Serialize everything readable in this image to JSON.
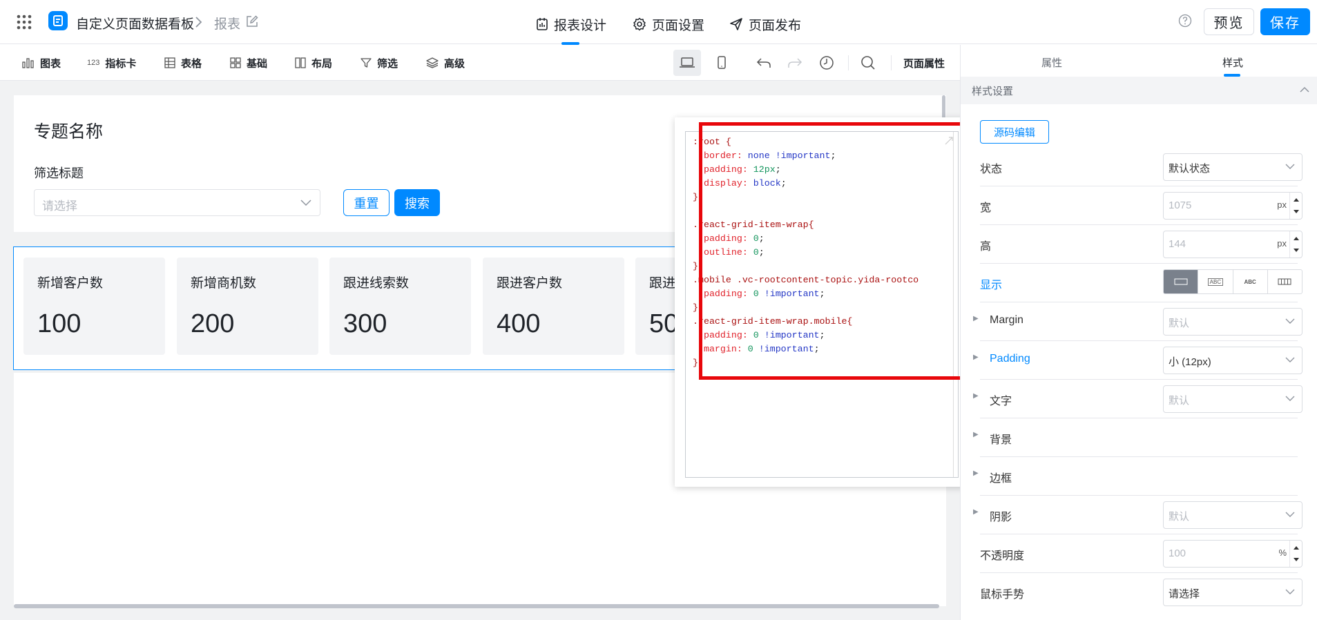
{
  "header": {
    "app_title": "自定义页面数据看板",
    "breadcrumb_page": "报表",
    "tabs": [
      {
        "label": "报表设计",
        "icon": "report-design-icon",
        "active": true
      },
      {
        "label": "页面设置",
        "icon": "gear-icon",
        "active": false
      },
      {
        "label": "页面发布",
        "icon": "send-icon",
        "active": false
      }
    ],
    "preview_label": "预览",
    "save_label": "保存",
    "accent_color": "#0089ff"
  },
  "toolbar": {
    "items": [
      {
        "label": "图表",
        "icon": "bar-chart-icon"
      },
      {
        "label": "指标卡",
        "icon": "metric-card-icon",
        "icon_text": "123"
      },
      {
        "label": "表格",
        "icon": "table-icon"
      },
      {
        "label": "基础",
        "icon": "grid-icon"
      },
      {
        "label": "布局",
        "icon": "layout-icon"
      },
      {
        "label": "筛选",
        "icon": "filter-icon"
      },
      {
        "label": "高级",
        "icon": "layers-icon"
      }
    ],
    "page_props_label": "页面属性"
  },
  "canvas": {
    "topic_title": "专题名称",
    "filter_title": "筛选标题",
    "filter_placeholder": "请选择",
    "reset_label": "重置",
    "search_label": "搜索",
    "metrics": [
      {
        "label": "新增客户数",
        "value": "100"
      },
      {
        "label": "新增商机数",
        "value": "200"
      },
      {
        "label": "跟进线索数",
        "value": "300"
      },
      {
        "label": "跟进客户数",
        "value": "400"
      },
      {
        "label": "跟进",
        "value": "50"
      }
    ]
  },
  "code_editor": {
    "lines": [
      [
        {
          "t": ":root {",
          "c": "sel"
        }
      ],
      [
        {
          "t": "  border: ",
          "c": "prop"
        },
        {
          "t": "none !important",
          "c": "kw"
        },
        {
          "t": ";",
          "c": "plain"
        }
      ],
      [
        {
          "t": "  padding: ",
          "c": "prop"
        },
        {
          "t": "12px",
          "c": "num"
        },
        {
          "t": ";",
          "c": "plain"
        }
      ],
      [
        {
          "t": "  display: ",
          "c": "prop"
        },
        {
          "t": "block",
          "c": "kw"
        },
        {
          "t": ";",
          "c": "plain"
        }
      ],
      [
        {
          "t": "}",
          "c": "sel"
        }
      ],
      [
        {
          "t": "",
          "c": "plain"
        }
      ],
      [
        {
          "t": ".react-grid-item-wrap{",
          "c": "sel"
        }
      ],
      [
        {
          "t": "  padding: ",
          "c": "prop"
        },
        {
          "t": "0",
          "c": "num"
        },
        {
          "t": ";",
          "c": "plain"
        }
      ],
      [
        {
          "t": "  outline: ",
          "c": "prop"
        },
        {
          "t": "0",
          "c": "num"
        },
        {
          "t": ";",
          "c": "plain"
        }
      ],
      [
        {
          "t": "}",
          "c": "sel"
        }
      ],
      [
        {
          "t": ".mobile .vc-rootcontent-topic.yida-rootco",
          "c": "sel"
        }
      ],
      [
        {
          "t": "  padding: ",
          "c": "prop"
        },
        {
          "t": "0",
          "c": "num"
        },
        {
          "t": " !important",
          "c": "kw"
        },
        {
          "t": ";",
          "c": "plain"
        }
      ],
      [
        {
          "t": "}",
          "c": "sel"
        }
      ],
      [
        {
          "t": ".react-grid-item-wrap.mobile{",
          "c": "sel"
        }
      ],
      [
        {
          "t": "  padding: ",
          "c": "prop"
        },
        {
          "t": "0",
          "c": "num"
        },
        {
          "t": " !important",
          "c": "kw"
        },
        {
          "t": ";",
          "c": "plain"
        }
      ],
      [
        {
          "t": "  margin: ",
          "c": "prop"
        },
        {
          "t": "0",
          "c": "num"
        },
        {
          "t": " !important",
          "c": "kw"
        },
        {
          "t": ";",
          "c": "plain"
        }
      ],
      [
        {
          "t": "}",
          "c": "sel"
        }
      ]
    ]
  },
  "right_panel": {
    "tabs": [
      {
        "label": "属性",
        "active": false
      },
      {
        "label": "样式",
        "active": true
      }
    ],
    "section_title": "样式设置",
    "source_edit_label": "源码编辑",
    "rows": {
      "state": {
        "label": "状态",
        "value": "默认状态"
      },
      "width": {
        "label": "宽",
        "value": "1075",
        "unit": "px"
      },
      "height": {
        "label": "高",
        "value": "144",
        "unit": "px"
      },
      "display": {
        "label": "显示",
        "options": [
          "block",
          "ABC",
          "ABC",
          "flex"
        ]
      },
      "margin": {
        "label": "Margin",
        "value": "默认"
      },
      "padding": {
        "label": "Padding",
        "value": "小 (12px)"
      },
      "text": {
        "label": "文字",
        "value": "默认"
      },
      "background": {
        "label": "背景"
      },
      "border": {
        "label": "边框"
      },
      "shadow": {
        "label": "阴影",
        "value": "默认"
      },
      "opacity": {
        "label": "不透明度",
        "value": "100",
        "unit": "%"
      },
      "cursor": {
        "label": "鼠标手势",
        "value": "请选择"
      }
    }
  }
}
